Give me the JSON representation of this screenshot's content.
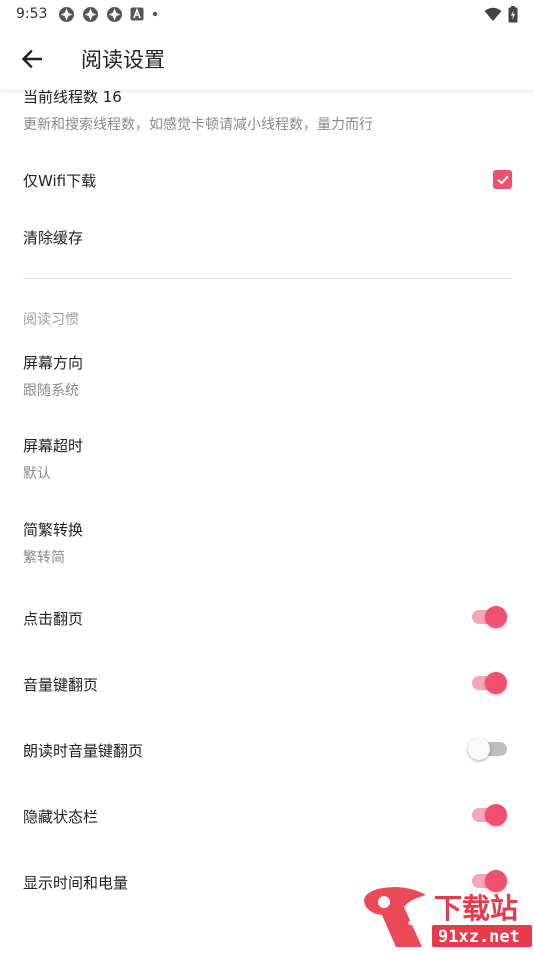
{
  "status_bar": {
    "time": "9:53",
    "icons": [
      "app-notification-icon",
      "app-notification-icon",
      "app-notification-icon",
      "a-badge-icon",
      "dot-icon",
      "wifi-icon",
      "battery-charging-icon"
    ]
  },
  "toolbar": {
    "title": "阅读设置",
    "back_icon": "arrow-left-icon"
  },
  "settings": {
    "thread_count": {
      "title": "当前线程数 16",
      "subtitle": "更新和搜索线程数，如感觉卡顿请减小线程数，量力而行"
    },
    "wifi_download": {
      "title": "仅Wifi下载",
      "checked": true
    },
    "clear_cache": {
      "title": "清除缓存"
    }
  },
  "reading_habits": {
    "header": "阅读习惯",
    "screen_orientation": {
      "title": "屏幕方向",
      "value": "跟随系统"
    },
    "screen_timeout": {
      "title": "屏幕超时",
      "value": "默认"
    },
    "chinese_conversion": {
      "title": "简繁转换",
      "value": "繁转简"
    },
    "tap_page_turn": {
      "title": "点击翻页",
      "on": true
    },
    "volume_key_page_turn": {
      "title": "音量键翻页",
      "on": true
    },
    "read_aloud_volume_key": {
      "title": "朗读时音量键翻页",
      "on": false
    },
    "hide_status_bar": {
      "title": "隐藏状态栏",
      "on": true
    },
    "show_time_battery": {
      "title": "显示时间和电量",
      "on": true
    }
  },
  "colors": {
    "accent": "#f0506e",
    "accent_track": "#f7a8b8",
    "off_track": "#bdbdbd",
    "text_primary": "#212121",
    "text_secondary": "#8a8a8a",
    "divider": "#e6e6e6"
  },
  "watermark": {
    "text": "下载站",
    "domain": "91xz.net",
    "logo_text": "9"
  }
}
